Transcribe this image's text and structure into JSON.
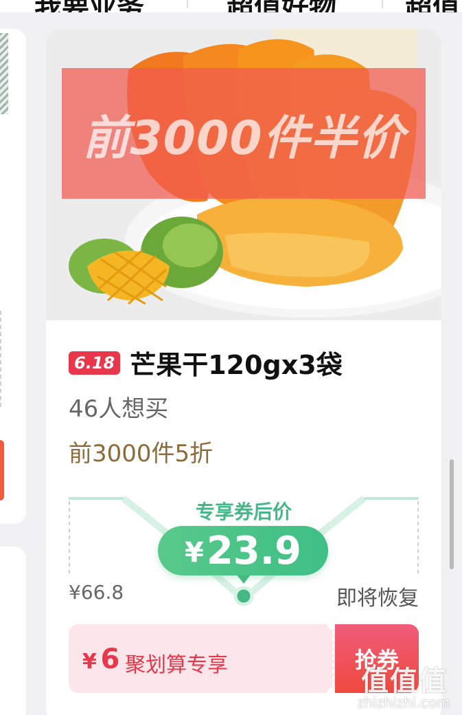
{
  "top_tabs": [
    "我要业务",
    "超值好物",
    "超值"
  ],
  "product": {
    "banner_text": "前3000件半价",
    "tag": "6.18",
    "title": "芒果干120gx3袋",
    "wants": "46人想买",
    "promo": "前3000件5折"
  },
  "price": {
    "coupon_label": "专享券后价",
    "currency": "¥",
    "value": "23.9",
    "original": "¥66.8",
    "restore_text": "即将恢复"
  },
  "coupon": {
    "yen": "¥",
    "amount": "6",
    "desc": "聚划算专享",
    "button": "抢券"
  },
  "watermark": {
    "logo": "值值值",
    "url": "zhizhizhi.com"
  },
  "colors": {
    "tag_red": "#e8374a",
    "price_green": "#46b787",
    "promo_brown": "#8c6a3a",
    "coupon_pink": "#fde6ea"
  }
}
